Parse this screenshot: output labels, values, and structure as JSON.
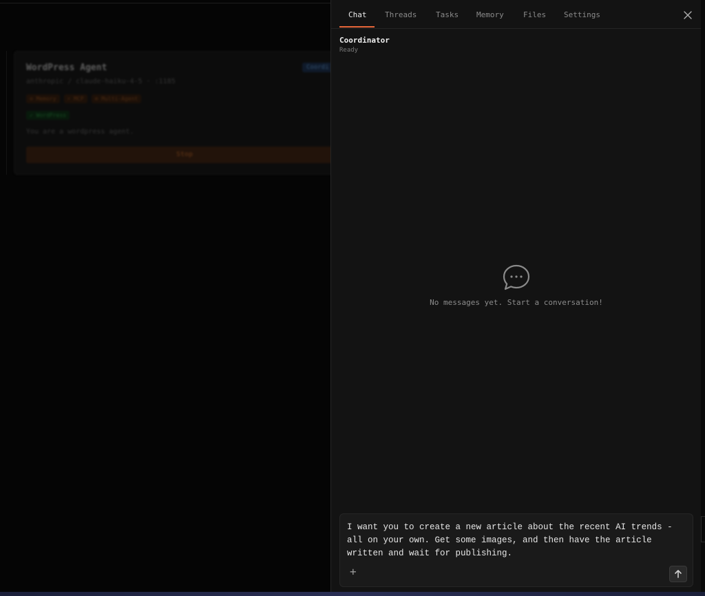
{
  "background_card": {
    "title": "WordPress Agent",
    "subtitle": "anthropic / claude-haiku-4-5 · :1185",
    "status_badge": "Coordi",
    "chips": [
      "⊙ Memory",
      "⚡ MCP",
      "⊕ Multi-Agent"
    ],
    "chip_green": "✓ WordPress",
    "description": "You are a wordpress agent.",
    "stop_label": "Stop"
  },
  "tabs": [
    {
      "label": "Chat",
      "active": true
    },
    {
      "label": "Threads",
      "active": false
    },
    {
      "label": "Tasks",
      "active": false
    },
    {
      "label": "Memory",
      "active": false
    },
    {
      "label": "Files",
      "active": false
    },
    {
      "label": "Settings",
      "active": false
    }
  ],
  "agent": {
    "name": "Coordinator",
    "status": "Ready"
  },
  "empty_state": {
    "icon": "chat-bubble-icon",
    "message": "No messages yet. Start a conversation!"
  },
  "composer": {
    "text": "I want you to create a new article about the recent AI trends -\nall on your own. Get some images, and then have the article\nwritten and wait for publishing.",
    "attach_icon": "plus-icon",
    "send_icon": "arrow-up-icon"
  },
  "colors": {
    "accent": "#e8673a",
    "panel_bg": "#131313",
    "page_bg": "#050505"
  }
}
